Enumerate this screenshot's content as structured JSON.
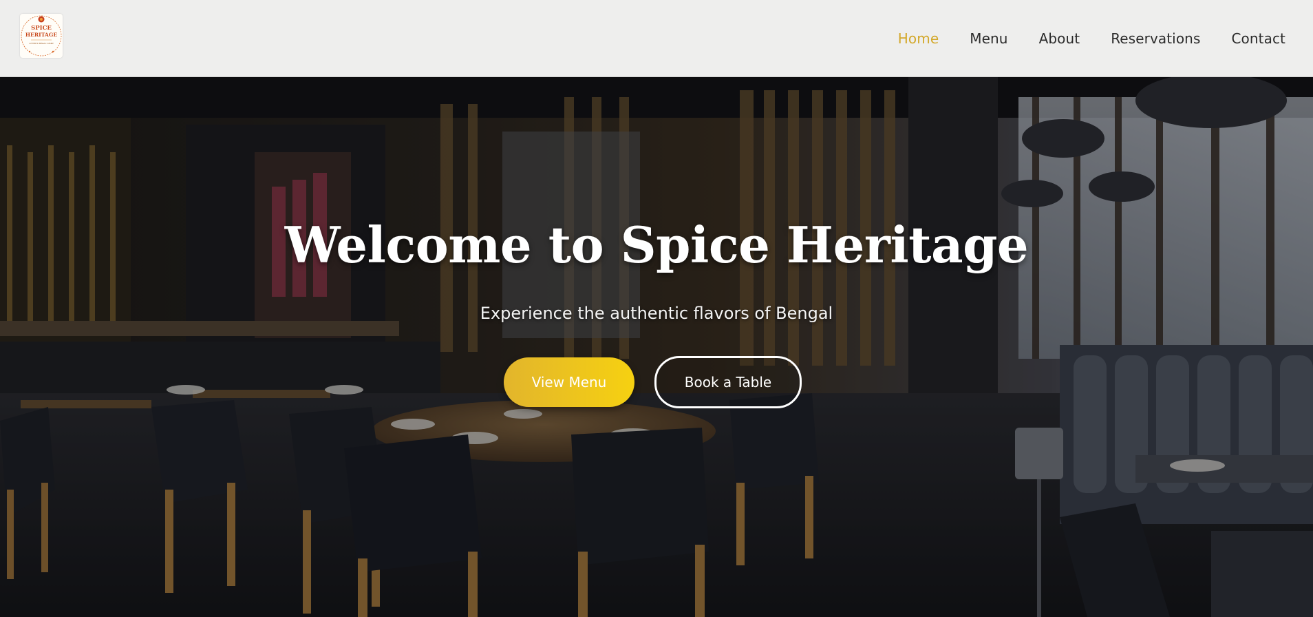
{
  "header": {
    "logo": {
      "line1": "SPICE",
      "line2": "HERITAGE",
      "tagline": "AUTHENTIC BENGALI CUISINE"
    },
    "nav": [
      {
        "label": "Home",
        "active": true
      },
      {
        "label": "Menu",
        "active": false
      },
      {
        "label": "About",
        "active": false
      },
      {
        "label": "Reservations",
        "active": false
      },
      {
        "label": "Contact",
        "active": false
      }
    ]
  },
  "hero": {
    "title": "Welcome to Spice Heritage",
    "subtitle": "Experience the authentic flavors of Bengal",
    "primary_button": "View Menu",
    "secondary_button": "Book a Table"
  },
  "colors": {
    "accent": "#d3a82a",
    "button_gradient_start": "#e2b52c",
    "button_gradient_end": "#f6d111",
    "header_bg": "#f6f6f5",
    "nav_text": "#2b2b2b"
  }
}
